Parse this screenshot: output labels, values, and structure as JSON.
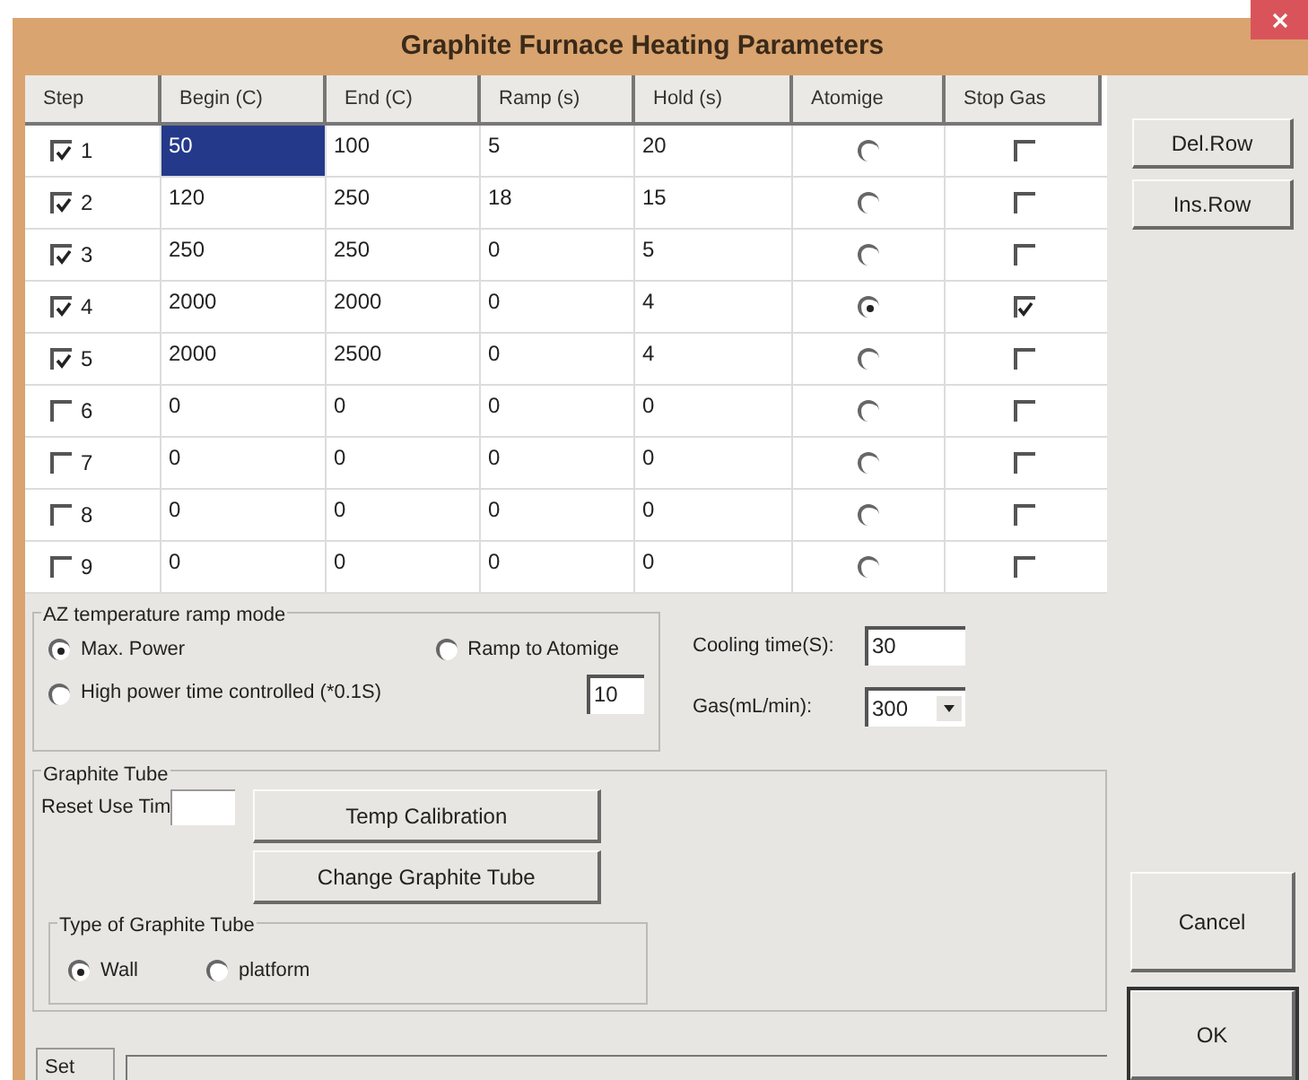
{
  "window": {
    "title": "Graphite Furnace Heating Parameters"
  },
  "table": {
    "columns": [
      "Step",
      "Begin (C)",
      "End (C)",
      "Ramp (s)",
      "Hold (s)",
      "Atomige",
      "Stop Gas"
    ],
    "rows": [
      {
        "enabled": true,
        "step": "1",
        "begin": "50",
        "end": "100",
        "ramp": "5",
        "hold": "20",
        "begin_selected": true,
        "atomize_selected": false,
        "stop_gas": false
      },
      {
        "enabled": true,
        "step": "2",
        "begin": "120",
        "end": "250",
        "ramp": "18",
        "hold": "15",
        "begin_selected": false,
        "atomize_selected": false,
        "stop_gas": false
      },
      {
        "enabled": true,
        "step": "3",
        "begin": "250",
        "end": "250",
        "ramp": "0",
        "hold": "5",
        "begin_selected": false,
        "atomize_selected": false,
        "stop_gas": false
      },
      {
        "enabled": true,
        "step": "4",
        "begin": "2000",
        "end": "2000",
        "ramp": "0",
        "hold": "4",
        "begin_selected": false,
        "atomize_selected": true,
        "stop_gas": true
      },
      {
        "enabled": true,
        "step": "5",
        "begin": "2000",
        "end": "2500",
        "ramp": "0",
        "hold": "4",
        "begin_selected": false,
        "atomize_selected": false,
        "stop_gas": false
      },
      {
        "enabled": false,
        "step": "6",
        "begin": "0",
        "end": "0",
        "ramp": "0",
        "hold": "0",
        "begin_selected": false,
        "atomize_selected": false,
        "stop_gas": false
      },
      {
        "enabled": false,
        "step": "7",
        "begin": "0",
        "end": "0",
        "ramp": "0",
        "hold": "0",
        "begin_selected": false,
        "atomize_selected": false,
        "stop_gas": false
      },
      {
        "enabled": false,
        "step": "8",
        "begin": "0",
        "end": "0",
        "ramp": "0",
        "hold": "0",
        "begin_selected": false,
        "atomize_selected": false,
        "stop_gas": false
      },
      {
        "enabled": false,
        "step": "9",
        "begin": "0",
        "end": "0",
        "ramp": "0",
        "hold": "0",
        "begin_selected": false,
        "atomize_selected": false,
        "stop_gas": false
      }
    ]
  },
  "row_buttons": [
    "Del.Row",
    "Ins.Row"
  ],
  "ramp_mode": {
    "title": "AZ temperature ramp mode",
    "options": [
      {
        "label": "Max. Power",
        "selected": true
      },
      {
        "label": "Ramp to Atomige",
        "selected": false
      },
      {
        "label": "High power time controlled (*0.1S)",
        "selected": false
      }
    ],
    "time_value": "10"
  },
  "cooling_time": {
    "label": "Cooling time(S):",
    "value": "30"
  },
  "gas": {
    "label": "Gas(mL/min):",
    "value": "300"
  },
  "graphite_tube": {
    "title": "Graphite Tube",
    "reset_label": "Reset Use Tim",
    "buttons": [
      "Temp Calibration",
      "Change Graphite Tube"
    ],
    "type_group": {
      "title": "Type of Graphite Tube",
      "options": [
        {
          "label": "Wall",
          "selected": true
        },
        {
          "label": "platform",
          "selected": false
        }
      ]
    }
  },
  "dialog_buttons": [
    "Cancel",
    "OK"
  ],
  "bottom_tab": {
    "label": "Set"
  }
}
